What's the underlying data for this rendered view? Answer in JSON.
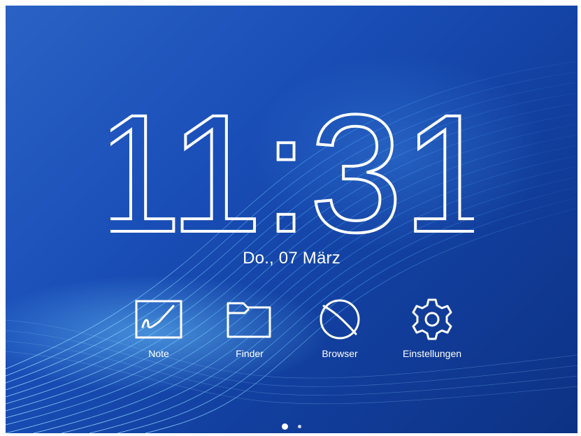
{
  "lockscreen": {
    "time": "11:31",
    "date": "Do., 07 März"
  },
  "apps": [
    {
      "label": "Note",
      "icon": "note-icon"
    },
    {
      "label": "Finder",
      "icon": "folder-icon"
    },
    {
      "label": "Browser",
      "icon": "browser-icon"
    },
    {
      "label": "Einstellungen",
      "icon": "gear-icon"
    }
  ],
  "pager": {
    "pages": 2,
    "current": 1
  },
  "colors": {
    "background": "#1a4fb8",
    "text": "#ffffff"
  }
}
